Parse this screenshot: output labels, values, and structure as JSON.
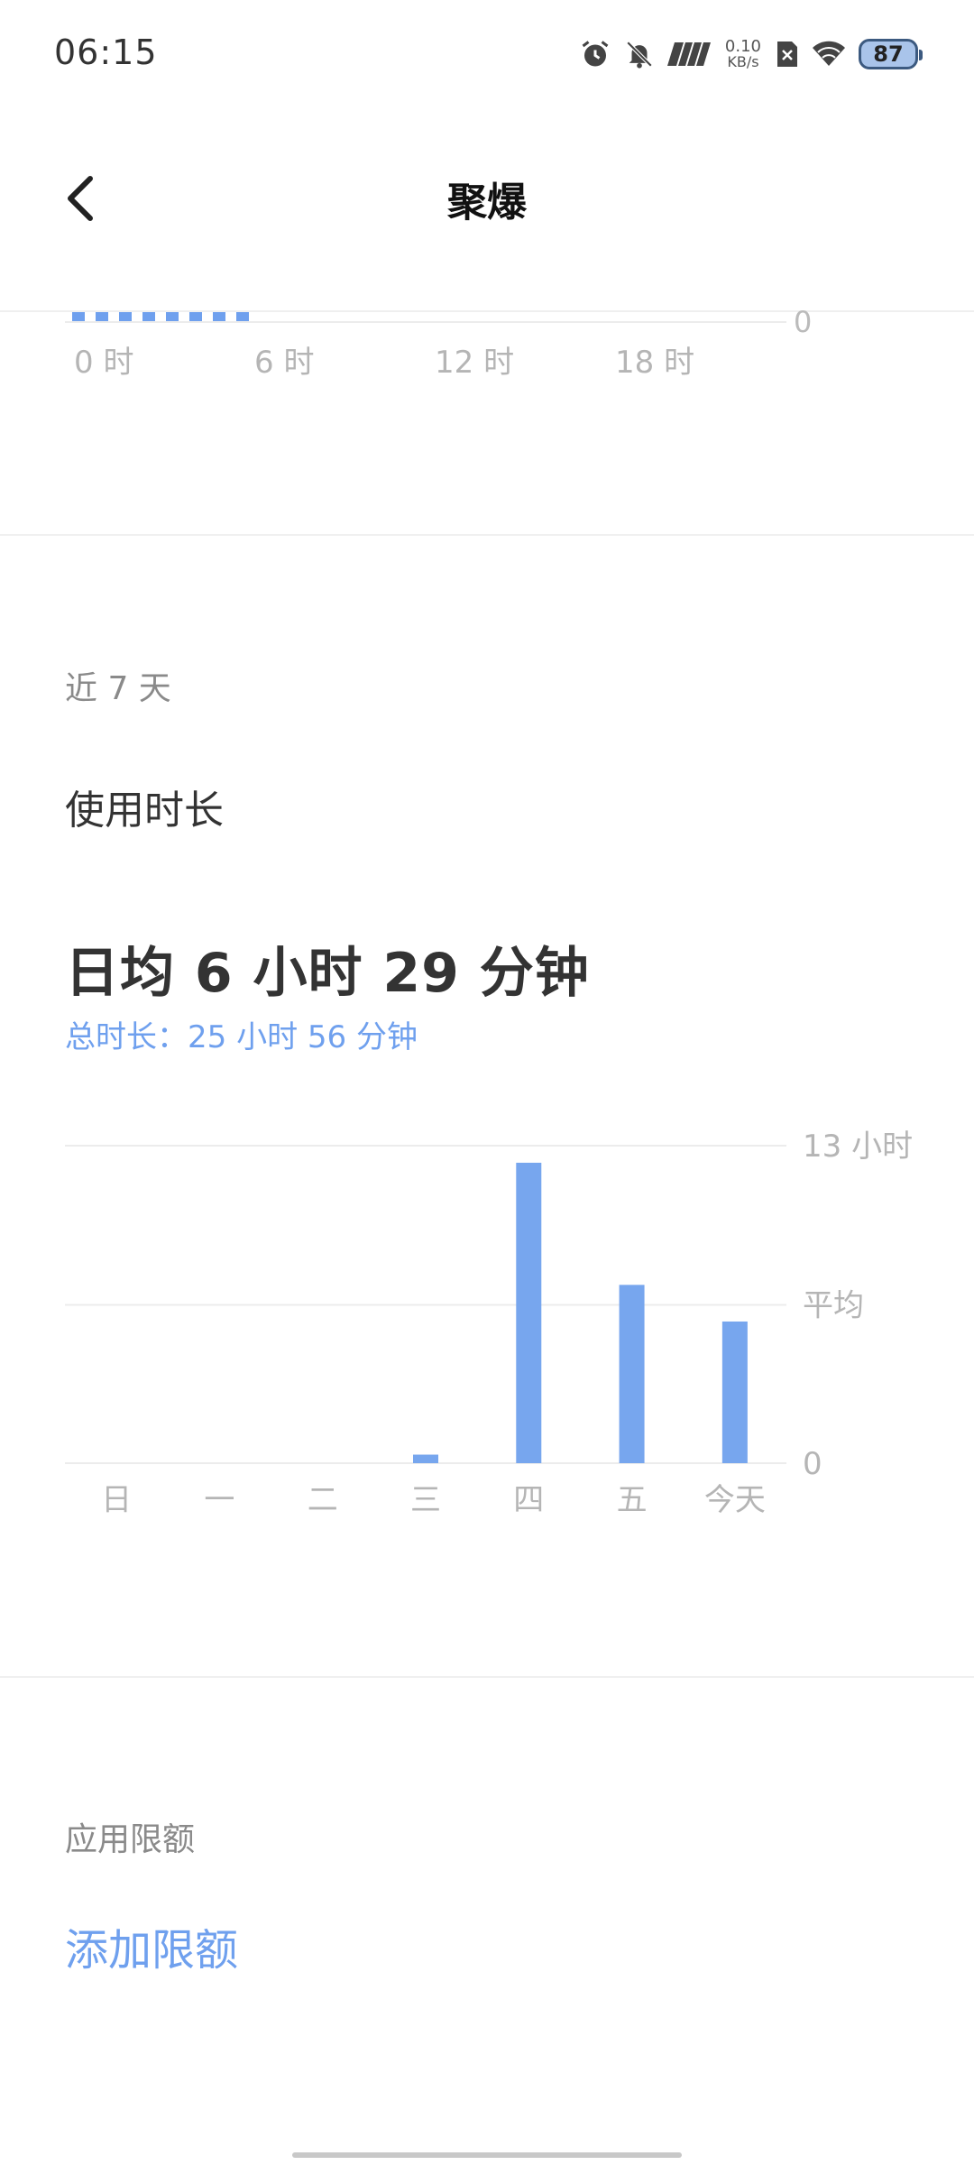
{
  "status_bar": {
    "time": "06:15",
    "net_speed_value": "0.10",
    "net_speed_unit": "KB/s",
    "signal_text": "7777",
    "battery": "87"
  },
  "header": {
    "title": "聚爆"
  },
  "daily_chart": {
    "zero_label": "0",
    "x_labels": [
      "0 时",
      "6 时",
      "12 时",
      "18 时"
    ],
    "dot_count": 8,
    "color": "#6fa0ee"
  },
  "weekly": {
    "range_label": "近 7 天",
    "metric_label": "使用时长",
    "average": "日均 6 小时 29 分钟",
    "total": "总时长：25 小时 56 分钟"
  },
  "chart_data": {
    "type": "bar",
    "categories": [
      "日",
      "一",
      "二",
      "三",
      "四",
      "五",
      "今天"
    ],
    "values": [
      0,
      0,
      0,
      0.35,
      12.3,
      7.3,
      5.8
    ],
    "y_tick_labels": {
      "max": "13 小时",
      "avg": "平均",
      "zero": "0"
    },
    "ylim": [
      0,
      13
    ],
    "average": 6.48,
    "unit": "小时",
    "color": "#77a6ee",
    "grid": true
  },
  "limits": {
    "section_label": "应用限额",
    "add_label": "添加限额"
  },
  "colors": {
    "accent": "#6fa0ee",
    "bar": "#77a6ee",
    "grid": "#ececec",
    "muted_text": "#b5b5b5"
  }
}
